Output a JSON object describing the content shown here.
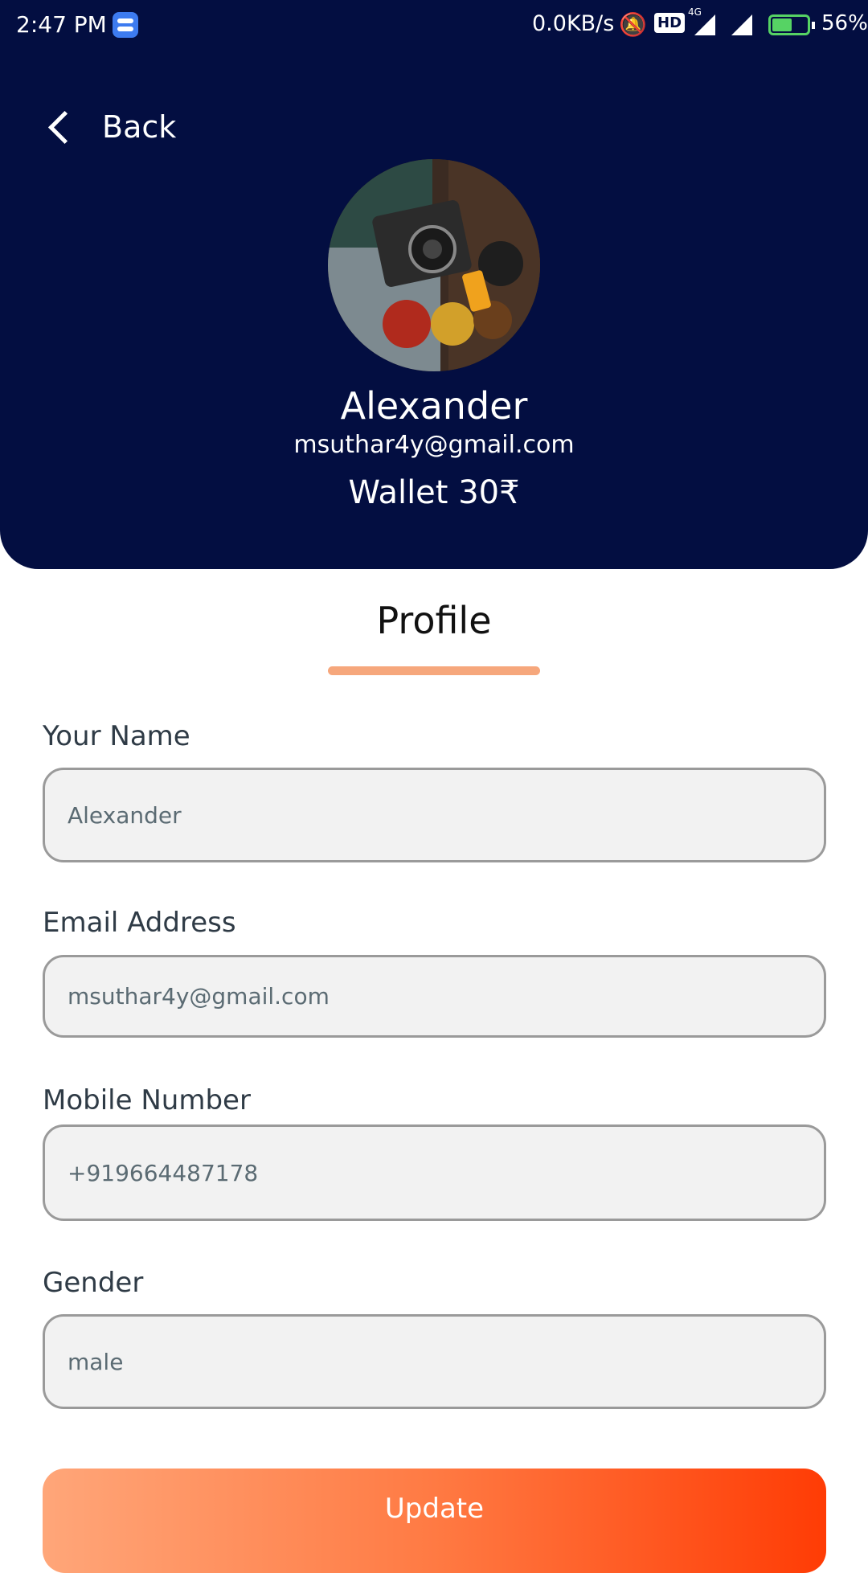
{
  "status_bar": {
    "time": "2:47 PM",
    "net_speed": "0.0KB/s",
    "hd": "HD",
    "network": "4G",
    "battery_pct": "56%",
    "battery_level": 0.56
  },
  "header": {
    "back_label": "Back",
    "name": "Alexander",
    "email": "msuthar4y@gmail.com",
    "wallet": "Wallet 30₹"
  },
  "tab": {
    "label": "Profile",
    "underline_color": "#f6a77c"
  },
  "form": {
    "name_label": "Your Name",
    "name_value": "Alexander",
    "email_label": "Email Address",
    "email_value": "msuthar4y@gmail.com",
    "mobile_label": "Mobile Number",
    "mobile_value": "+919664487178",
    "gender_label": "Gender",
    "gender_value": "male"
  },
  "button": {
    "update_label": "Update"
  },
  "colors": {
    "header_bg": "#030e41",
    "field_bg": "#f2f2f2",
    "button_gradient_start": "#ffa679",
    "button_gradient_end": "#ff3c05"
  },
  "icons": {
    "back": "chevron-left-icon",
    "notifications": "bell-off-icon",
    "signal": "signal-icon",
    "battery": "battery-charging-icon"
  }
}
